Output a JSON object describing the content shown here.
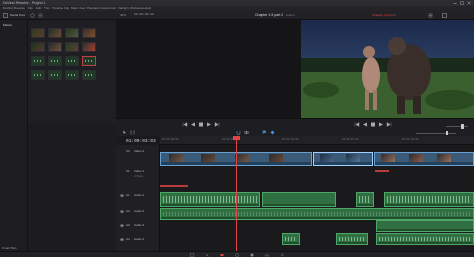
{
  "app": {
    "title": "DaVinci Resolve - Project 1",
    "project_title": "Chapter 1.5 part 2",
    "edited_badge": "Edited"
  },
  "menu": [
    "DaVinci Resolve",
    "File",
    "Edit",
    "Trim",
    "Timeline",
    "Clip",
    "Mark",
    "View",
    "Playback",
    "Fusion",
    "Color",
    "Fairlight",
    "Workspace",
    "Help"
  ],
  "toolbar": {
    "media_pool": "Media Pool",
    "zoom": "46%",
    "timecode_top": "00:00:00:00",
    "clip_name": "Chapter 1.5 part 2"
  },
  "mediapool": {
    "master_label": "Master",
    "smart_bins_label": "Smart Bins"
  },
  "timeline": {
    "timecode": "01:00:03:03",
    "tracks": [
      {
        "name": "Video 2",
        "id": "V2"
      },
      {
        "name": "Video 1",
        "id": "V1",
        "clips_label": "2 Clips"
      },
      {
        "name": "Audio 1",
        "id": "A1"
      },
      {
        "name": "Audio 2",
        "id": "A2"
      },
      {
        "name": "Audio 3",
        "id": "A3"
      },
      {
        "name": "Audio 4",
        "id": "A4"
      }
    ],
    "ruler_ticks": [
      "01:00:00:00",
      "01:00:05:00",
      "01:00:10:00",
      "01:00:15:00",
      "01:00:20:00"
    ]
  },
  "colors": {
    "accent": "#e04444",
    "video_clip": "#3a5a78",
    "audio_clip": "#2f6f42"
  }
}
